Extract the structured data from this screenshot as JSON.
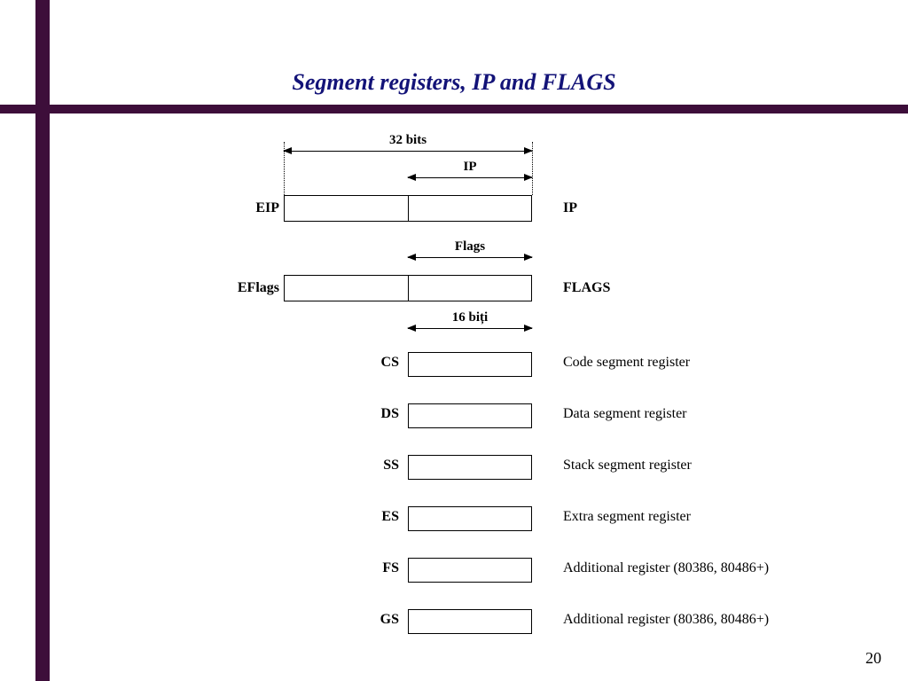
{
  "title": "Segment registers, IP and FLAGS",
  "page_number": "20",
  "dimensions": {
    "bits32": "32 bits",
    "ip": "IP",
    "flags": "Flags",
    "bits16": "16 biți"
  },
  "registers32": {
    "eip": {
      "label": "EIP",
      "desc": "IP"
    },
    "eflags": {
      "label": "EFlags",
      "desc": "FLAGS"
    }
  },
  "segment_registers": {
    "cs": {
      "label": "CS",
      "desc": "Code segment register"
    },
    "ds": {
      "label": "DS",
      "desc": "Data segment register"
    },
    "ss": {
      "label": "SS",
      "desc": "Stack segment register"
    },
    "es": {
      "label": "ES",
      "desc": "Extra segment register"
    },
    "fs": {
      "label": "FS",
      "desc": "Additional register (80386, 80486+)"
    },
    "gs": {
      "label": "GS",
      "desc": "Additional register (80386, 80486+)"
    }
  }
}
